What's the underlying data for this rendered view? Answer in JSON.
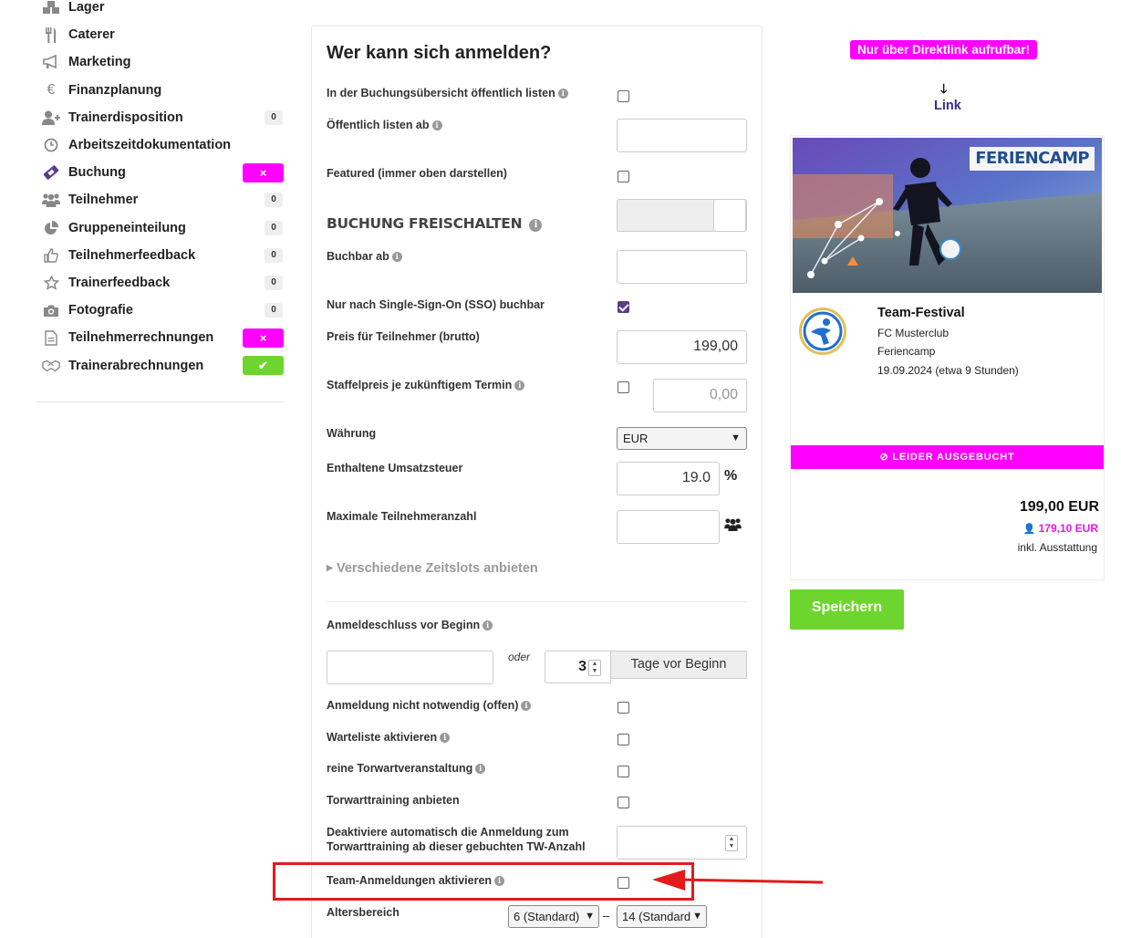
{
  "sidebar": {
    "items": [
      {
        "label": "Lager",
        "icon": "boxes-icon"
      },
      {
        "label": "Caterer",
        "icon": "cutlery-icon"
      },
      {
        "label": "Marketing",
        "icon": "megaphone-icon"
      },
      {
        "label": "Finanzplanung",
        "icon": "euro-icon"
      },
      {
        "label": "Trainerdisposition",
        "icon": "user-plus-icon",
        "count": "0"
      },
      {
        "label": "Arbeitszeitdokumentation",
        "icon": "clock-icon"
      },
      {
        "label": "Buchung",
        "icon": "ticket-icon",
        "status": "×",
        "status_color": "#ff00ff"
      },
      {
        "label": "Teilnehmer",
        "icon": "users-icon",
        "count": "0"
      },
      {
        "label": "Gruppeneinteilung",
        "icon": "pie-chart-icon",
        "count": "0"
      },
      {
        "label": "Teilnehmerfeedback",
        "icon": "thumbs-up-icon",
        "count": "0"
      },
      {
        "label": "Trainerfeedback",
        "icon": "star-icon",
        "count": "0"
      },
      {
        "label": "Fotografie",
        "icon": "camera-icon",
        "count": "0"
      },
      {
        "label": "Teilnehmerrechnungen",
        "icon": "document-icon",
        "status": "×",
        "status_color": "#ff00ff"
      },
      {
        "label": "Trainerabrechnungen",
        "icon": "handshake-icon",
        "status": "✔",
        "status_color": "#6dd52d"
      }
    ]
  },
  "form": {
    "title": "Wer kann sich anmelden?",
    "listen_label": "In der Buchungsübersicht öffentlich listen",
    "listen_checked": false,
    "listen_ab_label": "Öffentlich listen ab",
    "listen_ab_value": "",
    "featured_label": "Featured (immer oben darstellen)",
    "featured_checked": false,
    "freischalten_heading": "BUCHUNG FREISCHALTEN",
    "buchbar_ab_label": "Buchbar ab",
    "buchbar_ab_value": "",
    "sso_label": "Nur nach Single-Sign-On (SSO) buchbar",
    "sso_checked": true,
    "preis_label": "Preis für Teilnehmer (brutto)",
    "preis_value": "199,00",
    "staffel_label": "Staffelpreis je zukünftigem Termin",
    "staffel_checked": false,
    "staffel_placeholder": "0,00",
    "waehrung_label": "Währung",
    "waehrung_value": "EUR",
    "ust_label": "Enthaltene Umsatzsteuer",
    "ust_value": "19.0",
    "ust_unit": "%",
    "max_label": "Maximale Teilnehmeranzahl",
    "max_value": "",
    "zeitslots_label": "Verschiedene Zeitslots anbieten",
    "anmeldeschluss_label": "Anmeldeschluss vor Beginn",
    "anmeldeschluss_date": "",
    "oder": "oder",
    "tage_value": "3",
    "tage_suffix": "Tage vor Beginn",
    "nicht_notwendig_label": "Anmeldung nicht notwendig (offen)",
    "warteliste_label": "Warteliste aktivieren",
    "torwart_label": "reine Torwartveranstaltung",
    "torwarttraining_label": "Torwarttraining anbieten",
    "deaktiviere_label_1": "Deaktiviere automatisch die Anmeldung zum",
    "deaktiviere_label_2": "Torwarttraining ab dieser gebuchten TW-Anzahl",
    "deaktiviere_value": "",
    "team_label": "Team-Anmeldungen aktivieren",
    "team_checked": false,
    "alter_label": "Altersbereich",
    "alter_von": "6 (Standard)",
    "alter_bis": "14 (Standard)",
    "alter_sep": "–"
  },
  "preview": {
    "direct_notice": "Nur über Direktlink aufrufbar!",
    "link_label": "Link",
    "badge": "FERIENCAMP",
    "event_title": "Team-Festival",
    "club": "FC Musterclub",
    "category": "Feriencamp",
    "date": "19.09.2024 (etwa 9 Stunden)",
    "soldout": "⊘ LEIDER AUSGEBUCHT",
    "price": "199,00 EUR",
    "member_price": "179,10 EUR",
    "inkl": "inkl. Ausstattung"
  },
  "save_button": "Speichern",
  "colors": {
    "accent": "#ff00ff",
    "success": "#6dd52d",
    "checkbox": "#5b3b8c",
    "highlight": "#e31b1b"
  }
}
